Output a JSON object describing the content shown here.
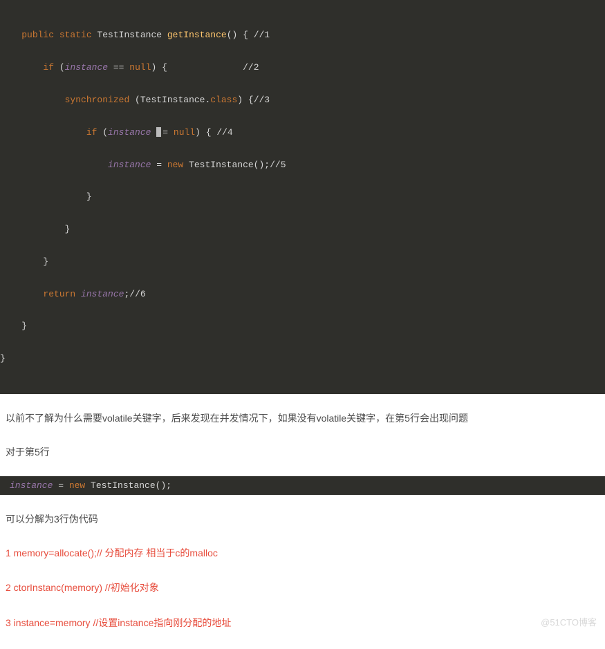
{
  "code1": {
    "l1": {
      "indent": "    ",
      "kw1": "public static",
      "type": " TestInstance ",
      "fn": "getInstance",
      "rest": "() { //1"
    },
    "l2": {
      "indent": "        ",
      "kw": "if",
      "mid": " (",
      "var": "instance",
      "op": " == ",
      "nul": "null",
      "rest": ") {              //2"
    },
    "l3": {
      "indent": "            ",
      "kw": "synchronized",
      "mid": " (TestInstance.",
      "cls": "class",
      "rest": ") {//3"
    },
    "l4": {
      "indent": "                ",
      "kw": "if",
      "mid": " (",
      "var": "instance",
      "op": "= ",
      "nul": "null",
      "rest": ") { //4"
    },
    "l5": {
      "indent": "                    ",
      "var": "instance",
      "eq": " = ",
      "kw": "new",
      "call": " TestInstance();//5"
    },
    "l6": {
      "indent": "                ",
      "brace": "}"
    },
    "l7": {
      "indent": "            ",
      "brace": "}"
    },
    "l8": {
      "indent": "        ",
      "brace": "}"
    },
    "l9": {
      "indent": "        ",
      "kw": "return",
      "sp": " ",
      "var": "instance",
      "rest": ";//6"
    },
    "l10": {
      "indent": "    ",
      "brace": "}"
    },
    "l11": {
      "indent": "",
      "brace": "}"
    }
  },
  "para1": "以前不了解为什么需要volatile关键字，后来发现在并发情况下，如果没有volatile关键字，在第5行会出现问题",
  "para2": "对于第5行",
  "inline": {
    "var": "instance",
    "eq": " = ",
    "kw": "new",
    "rest": " TestInstance();"
  },
  "para3": "可以分解为3行伪代码",
  "pseudo1": "1 memory=allocate();// 分配内存 相当于c的malloc",
  "pseudo2": "2 ctorInstanc(memory) //初始化对象",
  "pseudo3": "3 instance=memory //设置instance指向刚分配的地址",
  "watermark": "@51CTO博客"
}
